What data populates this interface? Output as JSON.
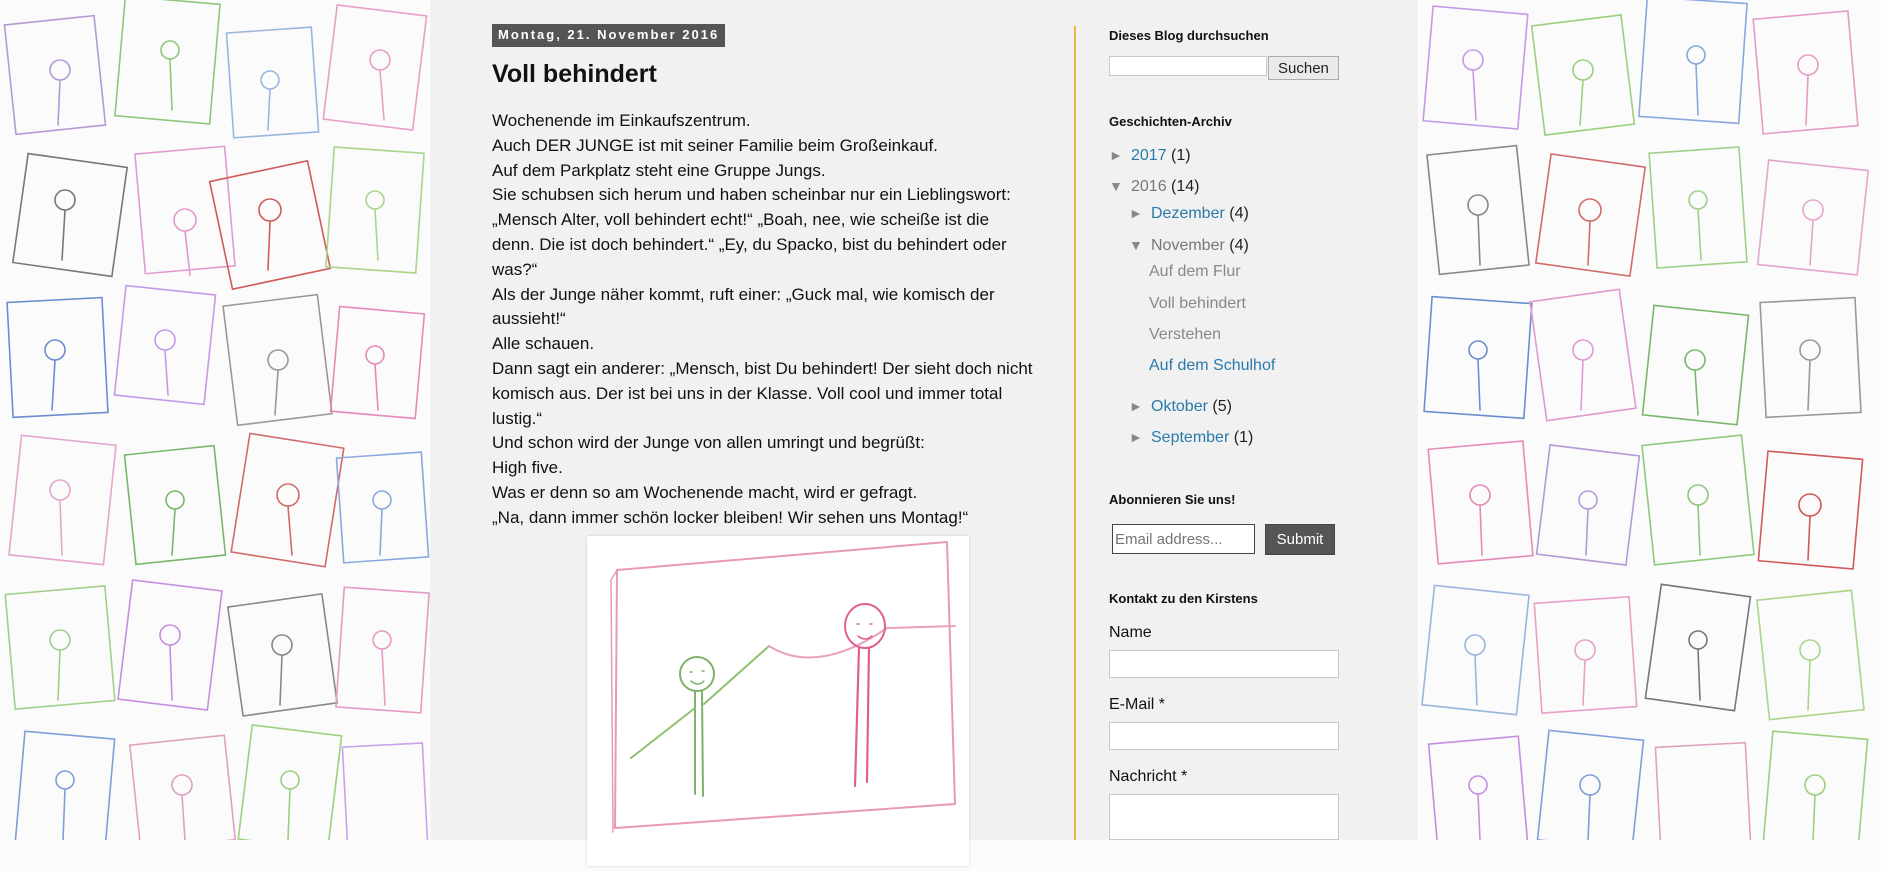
{
  "post": {
    "date": "Montag, 21. November 2016",
    "title": "Voll behindert",
    "lines": [
      "Wochenende im Einkaufszentrum.",
      "Auch DER JUNGE ist mit seiner Familie beim Großeinkauf.",
      "Auf dem Parkplatz steht eine Gruppe Jungs.",
      "Sie schubsen sich herum und haben scheinbar nur ein Lieblingswort:",
      "„Mensch Alter, voll behindert echt!“ „Boah, nee, wie scheiße ist die",
      "denn. Die ist doch behindert.“ „Ey, du Spacko, bist du behindert oder",
      "was?“",
      "Als der Junge näher kommt, ruft einer: „Guck mal, wie komisch der",
      "aussieht!“",
      "Alle schauen.",
      "Dann sagt ein anderer: „Mensch, bist Du behindert! Der sieht doch nicht",
      "komisch aus. Der ist bei uns in der Klasse. Voll cool und immer total",
      "lustig.“",
      "Und schon wird der Junge von allen umringt und begrüßt:",
      "High five.",
      "Was er denn so am Wochenende macht, wird er gefragt.",
      "„Na, dann immer schön locker bleiben! Wir sehen uns Montag!“"
    ]
  },
  "sidebar": {
    "search": {
      "title": "Dieses Blog durchsuchen",
      "button": "Suchen",
      "value": ""
    },
    "archive": {
      "title": "Geschichten-Archiv",
      "years": [
        {
          "toggle": "►",
          "label": "2017",
          "count": "(1)"
        },
        {
          "toggle": "▼",
          "label": "2016",
          "count": "(14)"
        }
      ],
      "months": [
        {
          "toggle": "►",
          "label": "Dezember",
          "count": "(4)"
        },
        {
          "toggle": "▼",
          "label": "November",
          "count": "(4)"
        },
        {
          "toggle": "►",
          "label": "Oktober",
          "count": "(5)"
        },
        {
          "toggle": "►",
          "label": "September",
          "count": "(1)"
        }
      ],
      "posts": [
        "Auf dem Flur",
        "Voll behindert",
        "Verstehen",
        "Auf dem Schulhof"
      ]
    },
    "subscribe": {
      "title": "Abonnieren Sie uns!",
      "placeholder": "Email address...",
      "button": "Submit"
    },
    "contact": {
      "title": "Kontakt zu den Kirstens",
      "name_label": "Name",
      "email_label": "E-Mail *",
      "message_label": "Nachricht *"
    }
  },
  "colors": {
    "accent": "#f0b64a",
    "link": "#2a7aaa",
    "header_bg": "#555555"
  }
}
